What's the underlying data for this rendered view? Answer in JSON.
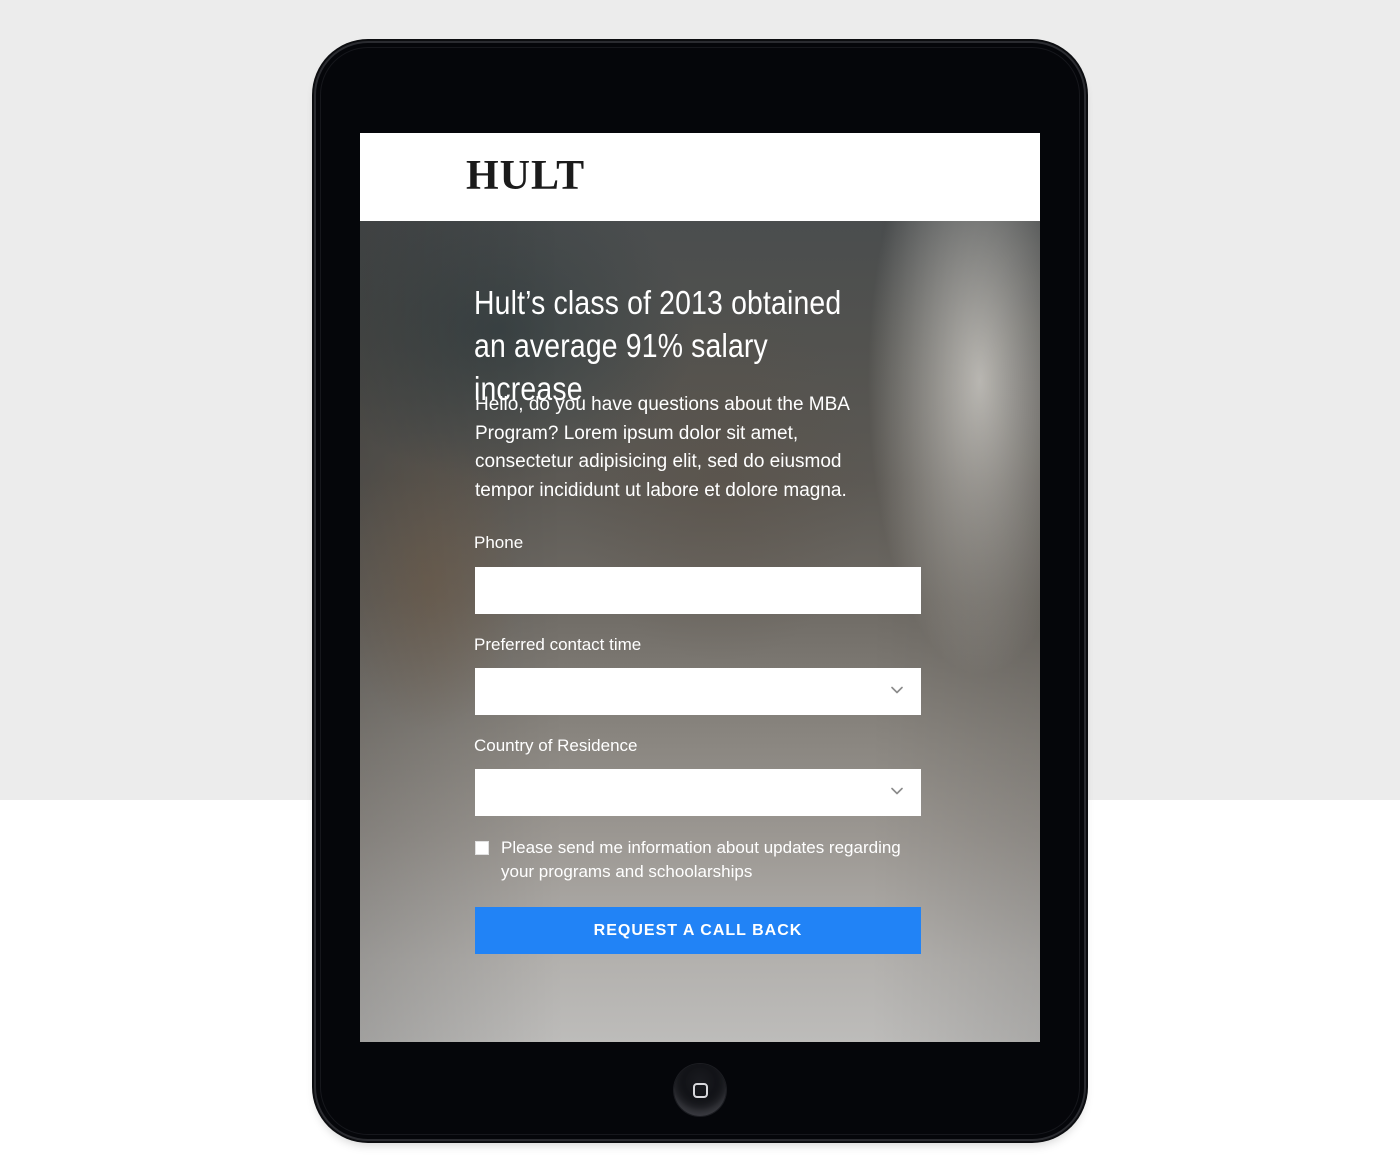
{
  "header": {
    "logo_text": "HULT"
  },
  "hero": {
    "headline_line1": "Hult’s class of 2013 obtained",
    "headline_line2": "an average 91% salary increase",
    "intro_line1": "Hello, do you have questions about the MBA",
    "intro_line2": "Program? Lorem ipsum dolor sit amet,",
    "intro_line3": "consectetur adipisicing elit, sed do eiusmod",
    "intro_line4": "tempor incididunt ut labore et dolore magna."
  },
  "form": {
    "phone_label": "Phone",
    "phone_value": "",
    "contact_time_label": "Preferred contact time",
    "contact_time_value": "",
    "country_label": "Country of Residence",
    "country_value": "",
    "consent_line1": "Please send me information about updates regarding",
    "consent_line2": "your programs and schoolarships",
    "consent_checked": false,
    "submit_label": "REQUEST A CALL BACK"
  },
  "colors": {
    "cta_background": "#2183f6",
    "page_background_top": "#ececec",
    "device_body": "#05060a"
  },
  "icons": {
    "select_arrow": "chevron-down-icon",
    "home_button": "home-button-icon"
  }
}
